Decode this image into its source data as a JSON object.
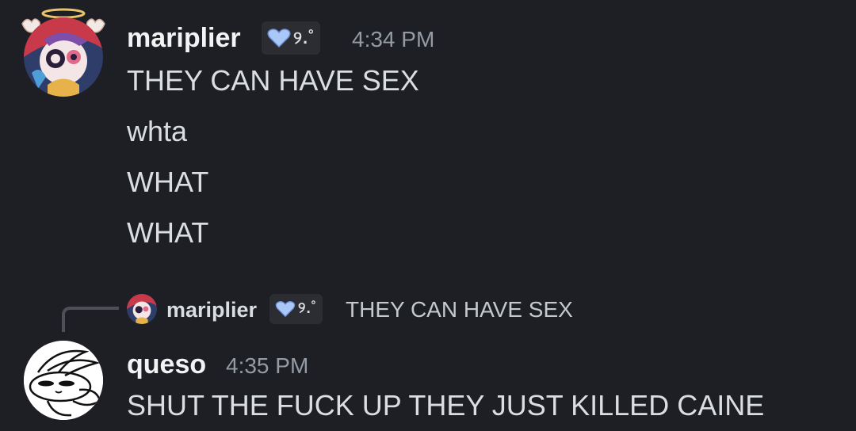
{
  "messages": [
    {
      "username": "mariplier",
      "tag_text": "୨.˚",
      "timestamp": "4:34 PM",
      "lines": [
        "THEY CAN HAVE SEX",
        "whta",
        "WHAT",
        "WHAT"
      ]
    },
    {
      "reply": {
        "username": "mariplier",
        "tag_text": "୨.˚",
        "text": "THEY CAN HAVE SEX"
      },
      "username": "queso",
      "timestamp": "4:35 PM",
      "lines": [
        "SHUT THE FUCK UP THEY JUST KILLED CAINE"
      ]
    }
  ],
  "colors": {
    "background": "#1e1f24",
    "username": "#f2f3f5",
    "message_text": "#dbdee1",
    "timestamp": "#949ba4",
    "tag_background": "#2b2d33",
    "heart": "#a9c8f7"
  },
  "icons": {
    "tag_icon": "heart-icon",
    "halo": "halo-icon"
  }
}
